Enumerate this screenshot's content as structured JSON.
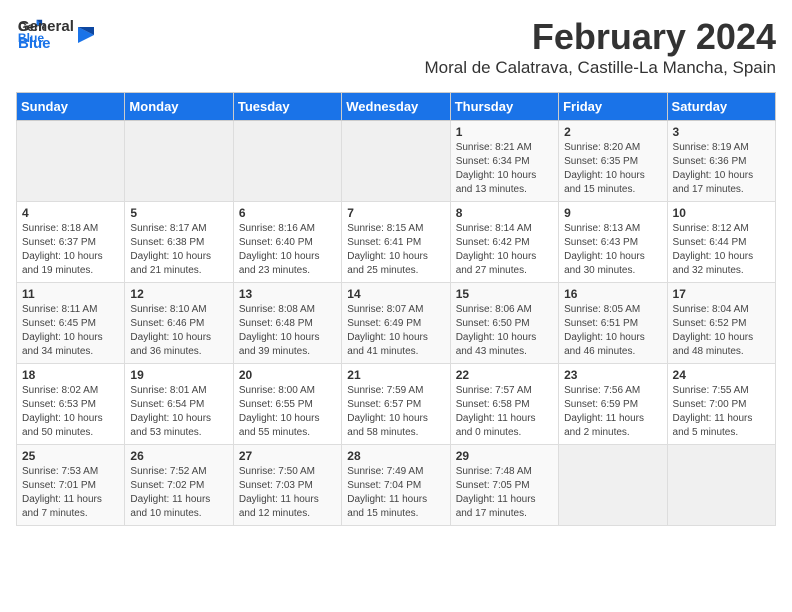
{
  "header": {
    "logo_line1": "General",
    "logo_line2": "Blue",
    "month_title": "February 2024",
    "subtitle": "Moral de Calatrava, Castille-La Mancha, Spain"
  },
  "calendar": {
    "days_of_week": [
      "Sunday",
      "Monday",
      "Tuesday",
      "Wednesday",
      "Thursday",
      "Friday",
      "Saturday"
    ],
    "weeks": [
      [
        {
          "day": "",
          "info": ""
        },
        {
          "day": "",
          "info": ""
        },
        {
          "day": "",
          "info": ""
        },
        {
          "day": "",
          "info": ""
        },
        {
          "day": "1",
          "info": "Sunrise: 8:21 AM\nSunset: 6:34 PM\nDaylight: 10 hours\nand 13 minutes."
        },
        {
          "day": "2",
          "info": "Sunrise: 8:20 AM\nSunset: 6:35 PM\nDaylight: 10 hours\nand 15 minutes."
        },
        {
          "day": "3",
          "info": "Sunrise: 8:19 AM\nSunset: 6:36 PM\nDaylight: 10 hours\nand 17 minutes."
        }
      ],
      [
        {
          "day": "4",
          "info": "Sunrise: 8:18 AM\nSunset: 6:37 PM\nDaylight: 10 hours\nand 19 minutes."
        },
        {
          "day": "5",
          "info": "Sunrise: 8:17 AM\nSunset: 6:38 PM\nDaylight: 10 hours\nand 21 minutes."
        },
        {
          "day": "6",
          "info": "Sunrise: 8:16 AM\nSunset: 6:40 PM\nDaylight: 10 hours\nand 23 minutes."
        },
        {
          "day": "7",
          "info": "Sunrise: 8:15 AM\nSunset: 6:41 PM\nDaylight: 10 hours\nand 25 minutes."
        },
        {
          "day": "8",
          "info": "Sunrise: 8:14 AM\nSunset: 6:42 PM\nDaylight: 10 hours\nand 27 minutes."
        },
        {
          "day": "9",
          "info": "Sunrise: 8:13 AM\nSunset: 6:43 PM\nDaylight: 10 hours\nand 30 minutes."
        },
        {
          "day": "10",
          "info": "Sunrise: 8:12 AM\nSunset: 6:44 PM\nDaylight: 10 hours\nand 32 minutes."
        }
      ],
      [
        {
          "day": "11",
          "info": "Sunrise: 8:11 AM\nSunset: 6:45 PM\nDaylight: 10 hours\nand 34 minutes."
        },
        {
          "day": "12",
          "info": "Sunrise: 8:10 AM\nSunset: 6:46 PM\nDaylight: 10 hours\nand 36 minutes."
        },
        {
          "day": "13",
          "info": "Sunrise: 8:08 AM\nSunset: 6:48 PM\nDaylight: 10 hours\nand 39 minutes."
        },
        {
          "day": "14",
          "info": "Sunrise: 8:07 AM\nSunset: 6:49 PM\nDaylight: 10 hours\nand 41 minutes."
        },
        {
          "day": "15",
          "info": "Sunrise: 8:06 AM\nSunset: 6:50 PM\nDaylight: 10 hours\nand 43 minutes."
        },
        {
          "day": "16",
          "info": "Sunrise: 8:05 AM\nSunset: 6:51 PM\nDaylight: 10 hours\nand 46 minutes."
        },
        {
          "day": "17",
          "info": "Sunrise: 8:04 AM\nSunset: 6:52 PM\nDaylight: 10 hours\nand 48 minutes."
        }
      ],
      [
        {
          "day": "18",
          "info": "Sunrise: 8:02 AM\nSunset: 6:53 PM\nDaylight: 10 hours\nand 50 minutes."
        },
        {
          "day": "19",
          "info": "Sunrise: 8:01 AM\nSunset: 6:54 PM\nDaylight: 10 hours\nand 53 minutes."
        },
        {
          "day": "20",
          "info": "Sunrise: 8:00 AM\nSunset: 6:55 PM\nDaylight: 10 hours\nand 55 minutes."
        },
        {
          "day": "21",
          "info": "Sunrise: 7:59 AM\nSunset: 6:57 PM\nDaylight: 10 hours\nand 58 minutes."
        },
        {
          "day": "22",
          "info": "Sunrise: 7:57 AM\nSunset: 6:58 PM\nDaylight: 11 hours\nand 0 minutes."
        },
        {
          "day": "23",
          "info": "Sunrise: 7:56 AM\nSunset: 6:59 PM\nDaylight: 11 hours\nand 2 minutes."
        },
        {
          "day": "24",
          "info": "Sunrise: 7:55 AM\nSunset: 7:00 PM\nDaylight: 11 hours\nand 5 minutes."
        }
      ],
      [
        {
          "day": "25",
          "info": "Sunrise: 7:53 AM\nSunset: 7:01 PM\nDaylight: 11 hours\nand 7 minutes."
        },
        {
          "day": "26",
          "info": "Sunrise: 7:52 AM\nSunset: 7:02 PM\nDaylight: 11 hours\nand 10 minutes."
        },
        {
          "day": "27",
          "info": "Sunrise: 7:50 AM\nSunset: 7:03 PM\nDaylight: 11 hours\nand 12 minutes."
        },
        {
          "day": "28",
          "info": "Sunrise: 7:49 AM\nSunset: 7:04 PM\nDaylight: 11 hours\nand 15 minutes."
        },
        {
          "day": "29",
          "info": "Sunrise: 7:48 AM\nSunset: 7:05 PM\nDaylight: 11 hours\nand 17 minutes."
        },
        {
          "day": "",
          "info": ""
        },
        {
          "day": "",
          "info": ""
        }
      ]
    ]
  }
}
